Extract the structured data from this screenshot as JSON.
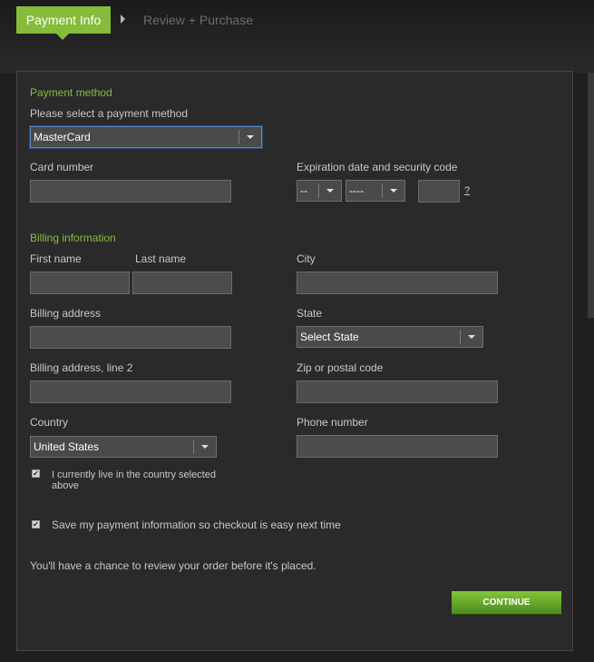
{
  "steps": {
    "active_label": "Payment Info",
    "next_label": "Review + Purchase"
  },
  "payment_method": {
    "section_title": "Payment method",
    "prompt": "Please select a payment method",
    "selected": "MasterCard"
  },
  "card": {
    "card_number_label": "Card number",
    "expiration_label": "Expiration date and security code",
    "month_value": "--",
    "year_value": "----",
    "help_link": "?"
  },
  "billing": {
    "section_title": "Billing information",
    "first_name_label": "First name",
    "last_name_label": "Last name",
    "city_label": "City",
    "address_label": "Billing address",
    "state_label": "State",
    "state_value": "Select State",
    "address2_label": "Billing address, line 2",
    "zip_label": "Zip or postal code",
    "country_label": "Country",
    "country_value": "United States",
    "phone_label": "Phone number"
  },
  "checkboxes": {
    "live_in_country": "I currently live in the country selected above",
    "save_payment": "Save my payment information so checkout is easy next time"
  },
  "review_note": "You'll have a chance to review your order before it's placed.",
  "continue_label": "CONTINUE",
  "colors": {
    "accent": "#86bc3a",
    "background": "#1f1f1f",
    "panel": "#2a2a2a",
    "input": "#4c4c4c"
  }
}
